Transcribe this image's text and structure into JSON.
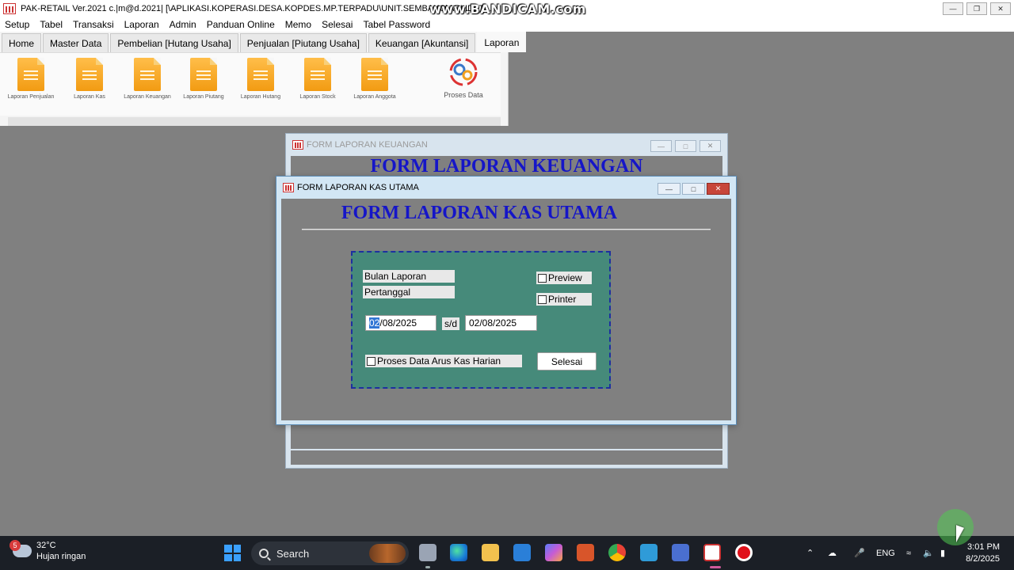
{
  "app": {
    "title": "PAK-RETAIL Ver.2021 c.|m@d.2021| [\\APLIKASI.KOPERASI.DESA.KOPDES.MP.TERPADU\\UNIT.SEMBAKO\\APLIDATA...",
    "watermark": "www.BANDICAM.com"
  },
  "menu": [
    "Setup",
    "Tabel",
    "Transaksi",
    "Laporan",
    "Admin",
    "Panduan Online",
    "Memo",
    "Selesai",
    "Tabel Password"
  ],
  "ribbon": {
    "tabs": [
      "Home",
      "Master Data",
      "Pembelian [Hutang Usaha]",
      "Penjualan [Piutang Usaha]",
      "Keuangan [Akuntansi]",
      "Laporan"
    ],
    "active_tab": "Laporan",
    "items": [
      "Laporan Penjualan",
      "Laporan Kas",
      "Laporan Keuangan",
      "Laporan Piutang",
      "Laporan Hutang",
      "Laporan Stock",
      "Laporan Anggota"
    ],
    "proses_label": "Proses Data"
  },
  "win_keuangan": {
    "title": "FORM LAPORAN KEUANGAN",
    "heading": "FORM LAPORAN KEUANGAN"
  },
  "win_kas": {
    "title": "FORM LAPORAN KAS UTAMA",
    "heading": "FORM LAPORAN KAS UTAMA",
    "bulan_label": "Bulan Laporan",
    "pertanggal_label": "Pertanggal",
    "preview_label": "Preview",
    "printer_label": "Printer",
    "date_from_sel": "02",
    "date_from_rest": "/08/2025",
    "sd_label": "s/d",
    "date_to": "02/08/2025",
    "proses_label": "Proses Data Arus Kas Harian",
    "selesai_label": "Selesai"
  },
  "taskbar": {
    "weather_badge": "5",
    "temp": "32°C",
    "weather": "Hujan ringan",
    "search": "Search",
    "lang": "ENG",
    "time": "3:01 PM",
    "date": "8/2/2025"
  }
}
